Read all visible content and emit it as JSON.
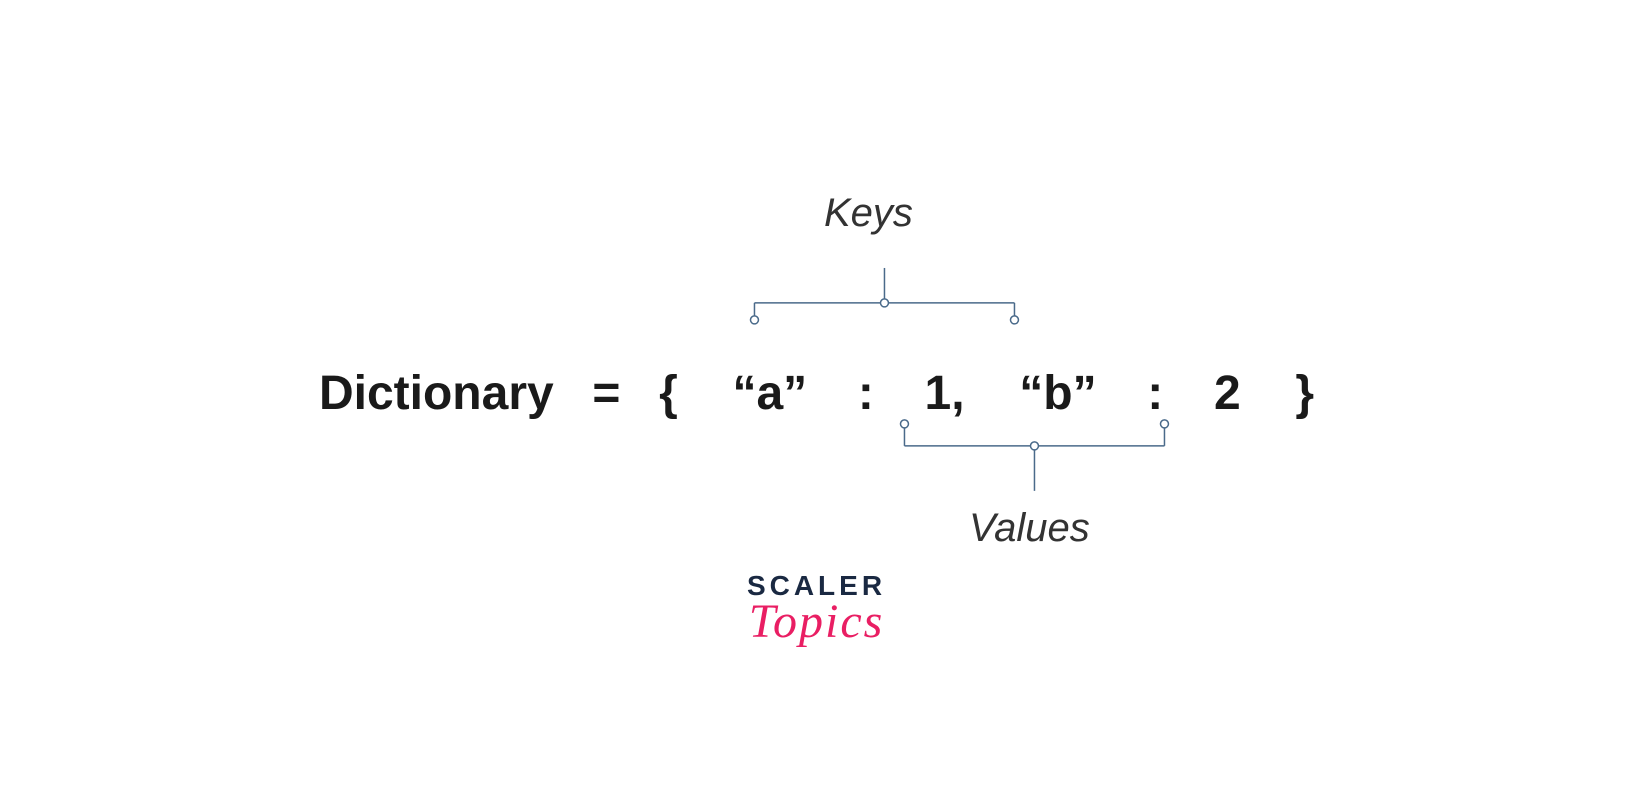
{
  "labels": {
    "keys": "Keys",
    "values": "Values"
  },
  "expression": {
    "var_name": "Dictionary",
    "equals": "=",
    "open_brace": "{",
    "key1": "“a”",
    "colon1": ":",
    "value1": "1,",
    "key2": "“b”",
    "colon2": ":",
    "value2": "2",
    "close_brace": "}"
  },
  "logo": {
    "line1": "SCALER",
    "line2": "Topics"
  },
  "colors": {
    "text": "#1a1a1a",
    "label": "#333333",
    "bracket": "#4a6a8a",
    "logo_dark": "#1a2942",
    "logo_pink": "#e91e63"
  }
}
